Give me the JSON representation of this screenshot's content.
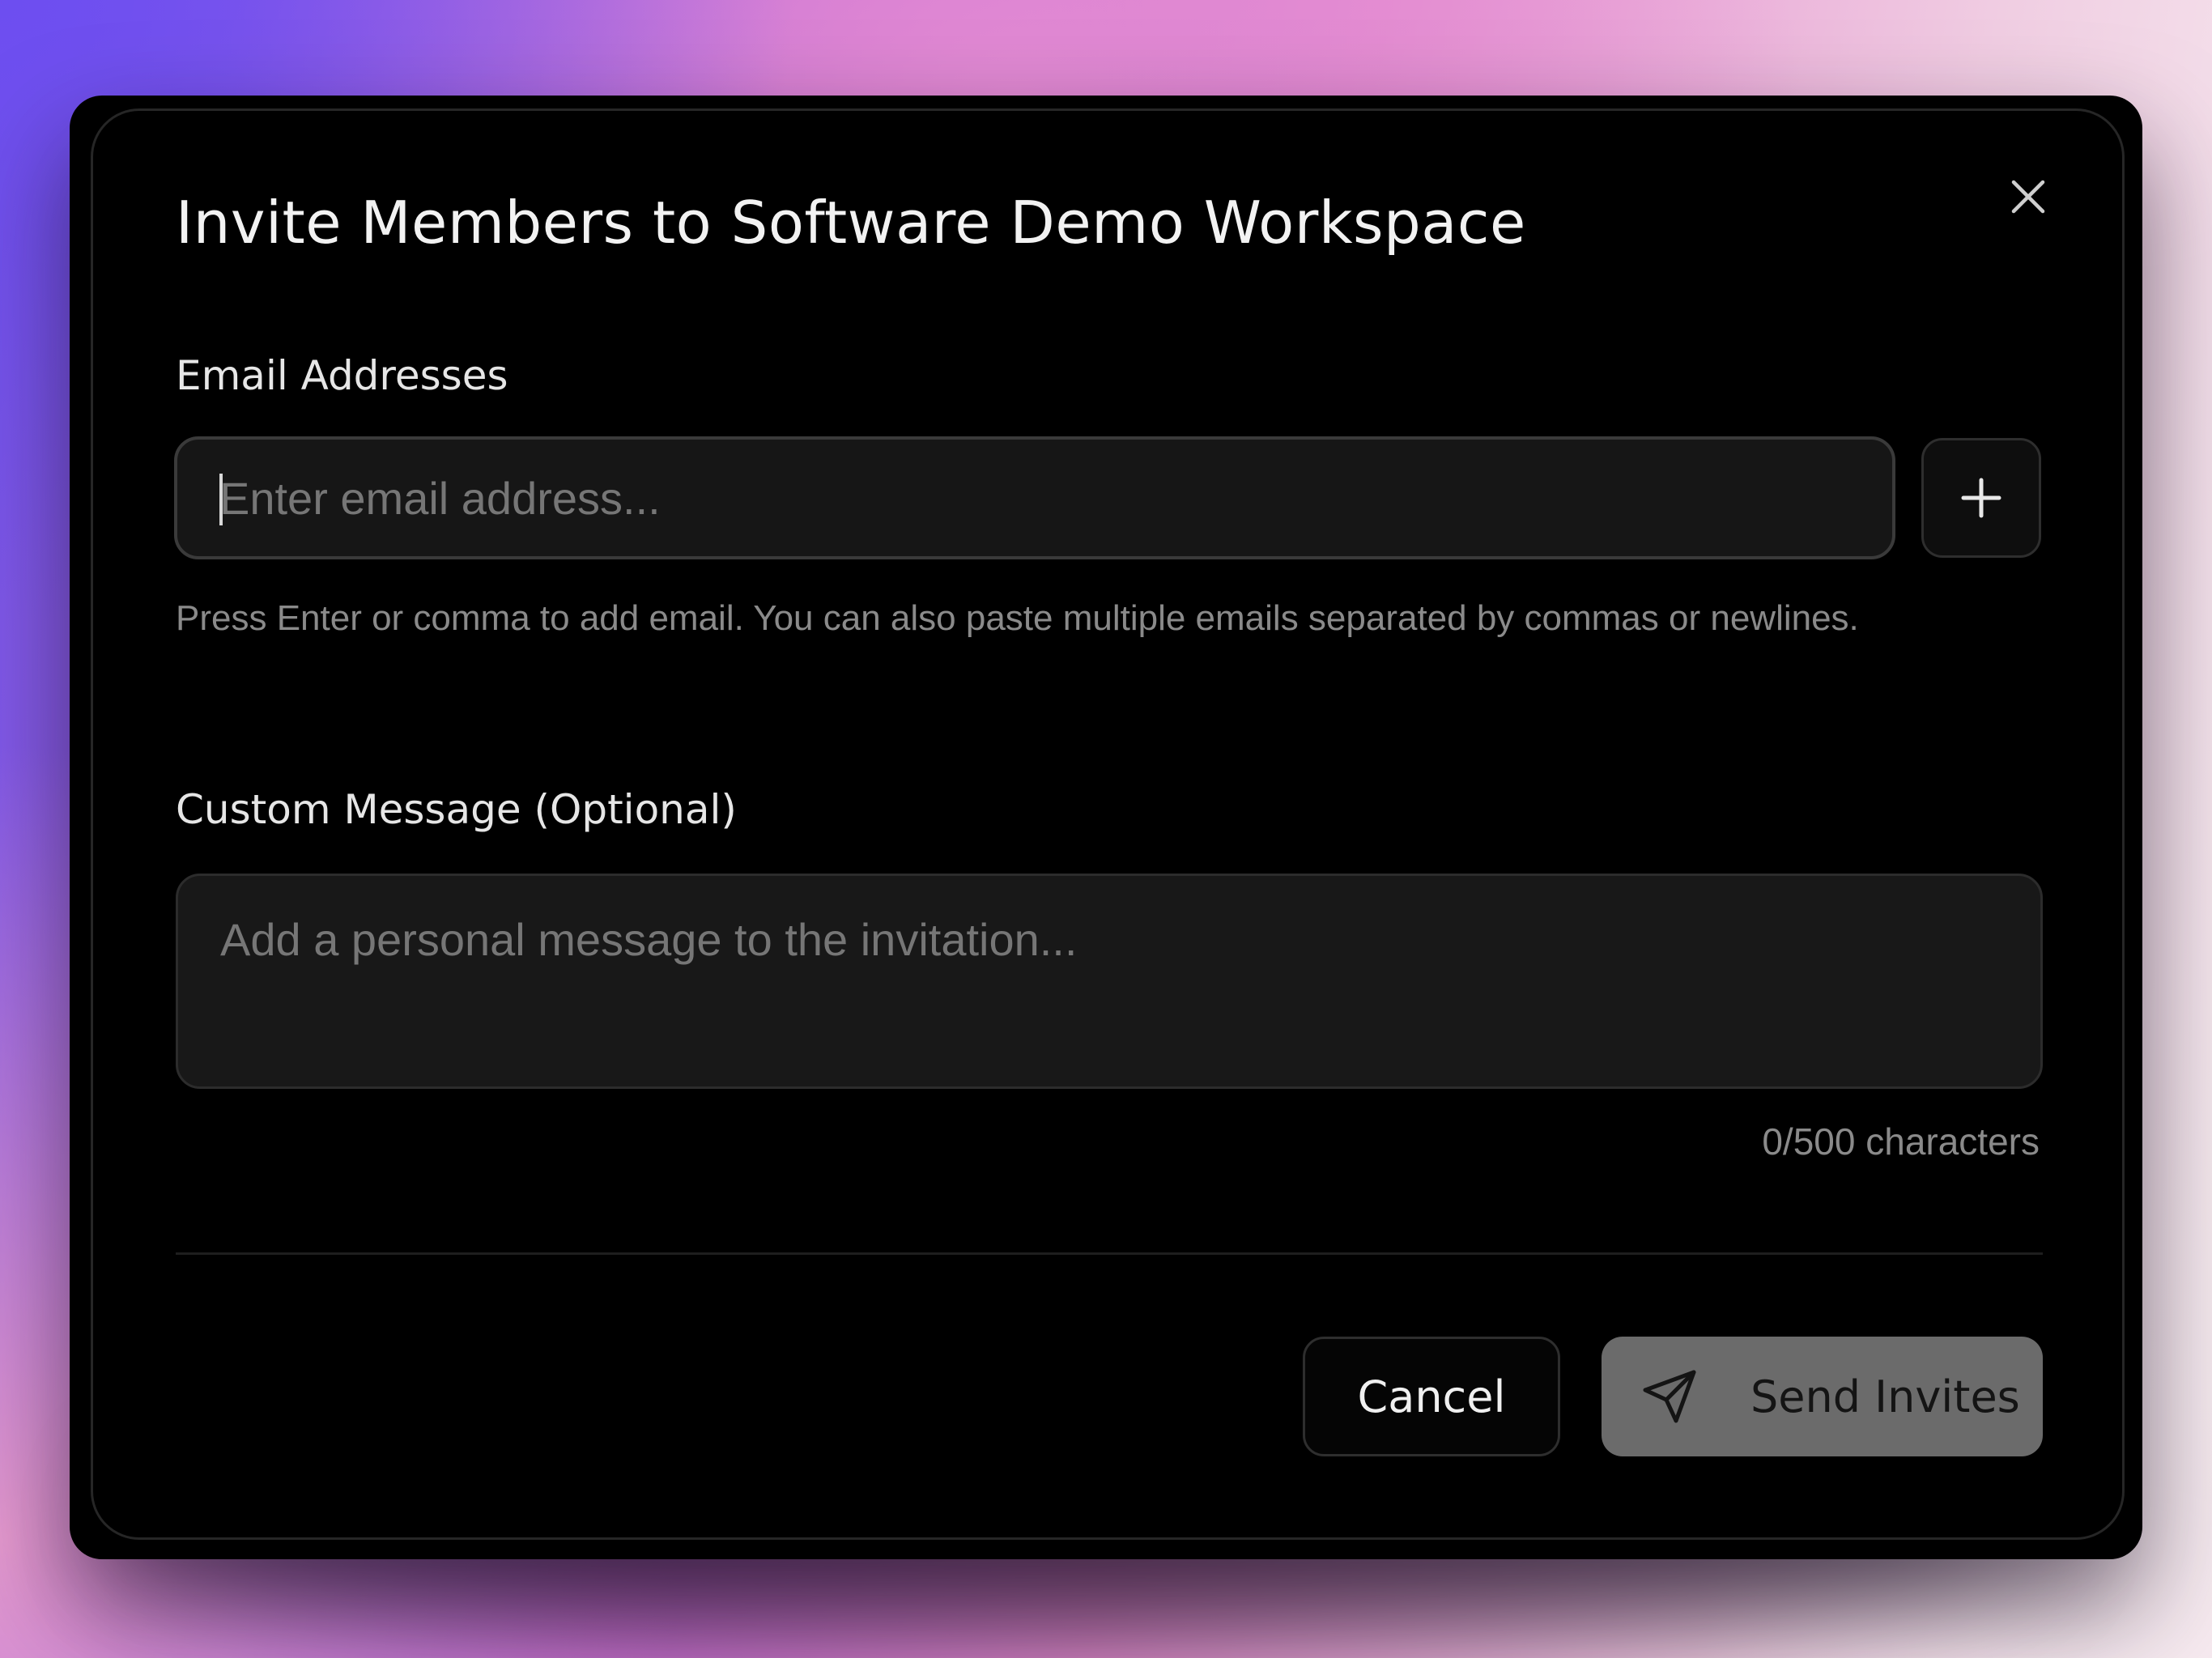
{
  "dialog": {
    "title": "Invite Members to Software Demo Workspace",
    "close_icon": "close-icon"
  },
  "email_section": {
    "label": "Email Addresses",
    "input_value": "",
    "input_placeholder": "Enter email address...",
    "add_icon": "plus-icon",
    "hint": "Press Enter or comma to add email. You can also paste multiple emails separated by commas or newlines."
  },
  "message_section": {
    "label": "Custom Message (Optional)",
    "textarea_value": "",
    "textarea_placeholder": "Add a personal message to the invitation...",
    "char_count": "0/500 characters"
  },
  "actions": {
    "cancel_label": "Cancel",
    "send_label": "Send Invites",
    "send_icon": "send-icon"
  },
  "colors": {
    "dialog_background": "#000000",
    "input_background": "#161616",
    "send_button_background": "#6b6b6b",
    "muted_text": "#8a8a8a"
  }
}
